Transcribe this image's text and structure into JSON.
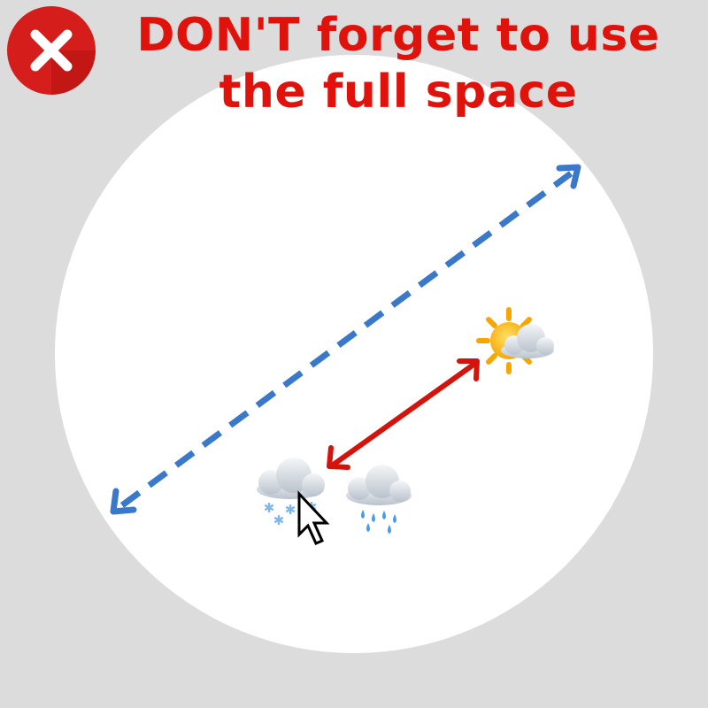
{
  "headline": {
    "line1": "DON'T forget to use",
    "line2": "the full space"
  },
  "colors": {
    "background": "#dcdcdc",
    "canvas_circle": "#ffffff",
    "headline_text": "#e0120c",
    "no_badge_fill": "#d51e1b",
    "full_span_arrow": "#3a78c9",
    "short_span_arrow": "#d4140c"
  },
  "icons": {
    "badge": "x-circle-icon",
    "sun_cloud": "sun-behind-cloud-icon",
    "snow_cloud": "snow-cloud-icon",
    "rain_cloud": "rain-cloud-icon",
    "cursor": "mouse-pointer-icon"
  }
}
